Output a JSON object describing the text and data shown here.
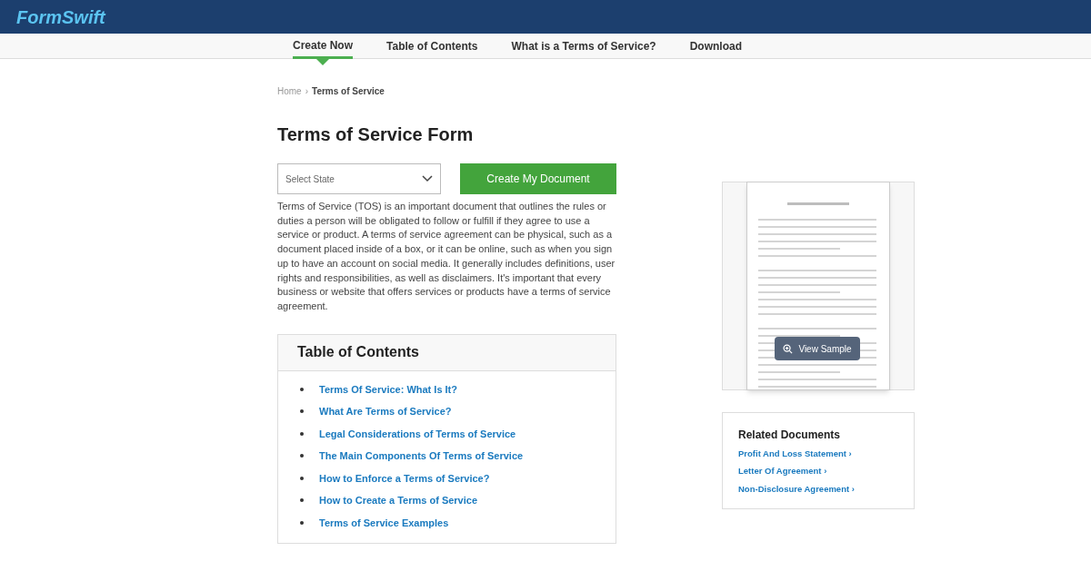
{
  "header": {
    "logo": "FormSwift"
  },
  "nav": [
    {
      "label": "Create Now",
      "selected": true
    },
    {
      "label": "Table of Contents",
      "selected": false
    },
    {
      "label": "What is a Terms of Service?",
      "selected": false
    },
    {
      "label": "Download",
      "selected": false
    }
  ],
  "breadcrumb": {
    "home": "Home",
    "separator": "›",
    "current": "Terms of Service"
  },
  "title": "Terms of Service Form",
  "state_select": {
    "placeholder": "Select State"
  },
  "create_button": "Create My Document",
  "description": "Terms of Service (TOS) is an important document that outlines the rules or duties a person will be obligated to follow or fulfill if they agree to use a service or product. A terms of service agreement can be physical, such as a document placed inside of a box, or it can be online, such as when you sign up to have an account on social media. It generally includes definitions, user rights and responsibilities, as well as disclaimers. It's important that every business or website that offers services or products have a terms of service agreement.",
  "toc": {
    "title": "Table of Contents",
    "items": [
      "Terms Of Service: What Is It?",
      "What Are Terms of Service?",
      "Legal Considerations of Terms of Service",
      "The Main Components Of Terms of Service",
      "How to Enforce a Terms of Service?",
      "How to Create a Terms of Service",
      "Terms of Service Examples"
    ]
  },
  "sample": {
    "kind": "picture",
    "button": "View Sample"
  },
  "related": {
    "title": "Related Documents",
    "links": [
      "Profit And Loss Statement ›",
      "Letter Of Agreement ›",
      "Non-Disclosure Agreement ›"
    ]
  }
}
